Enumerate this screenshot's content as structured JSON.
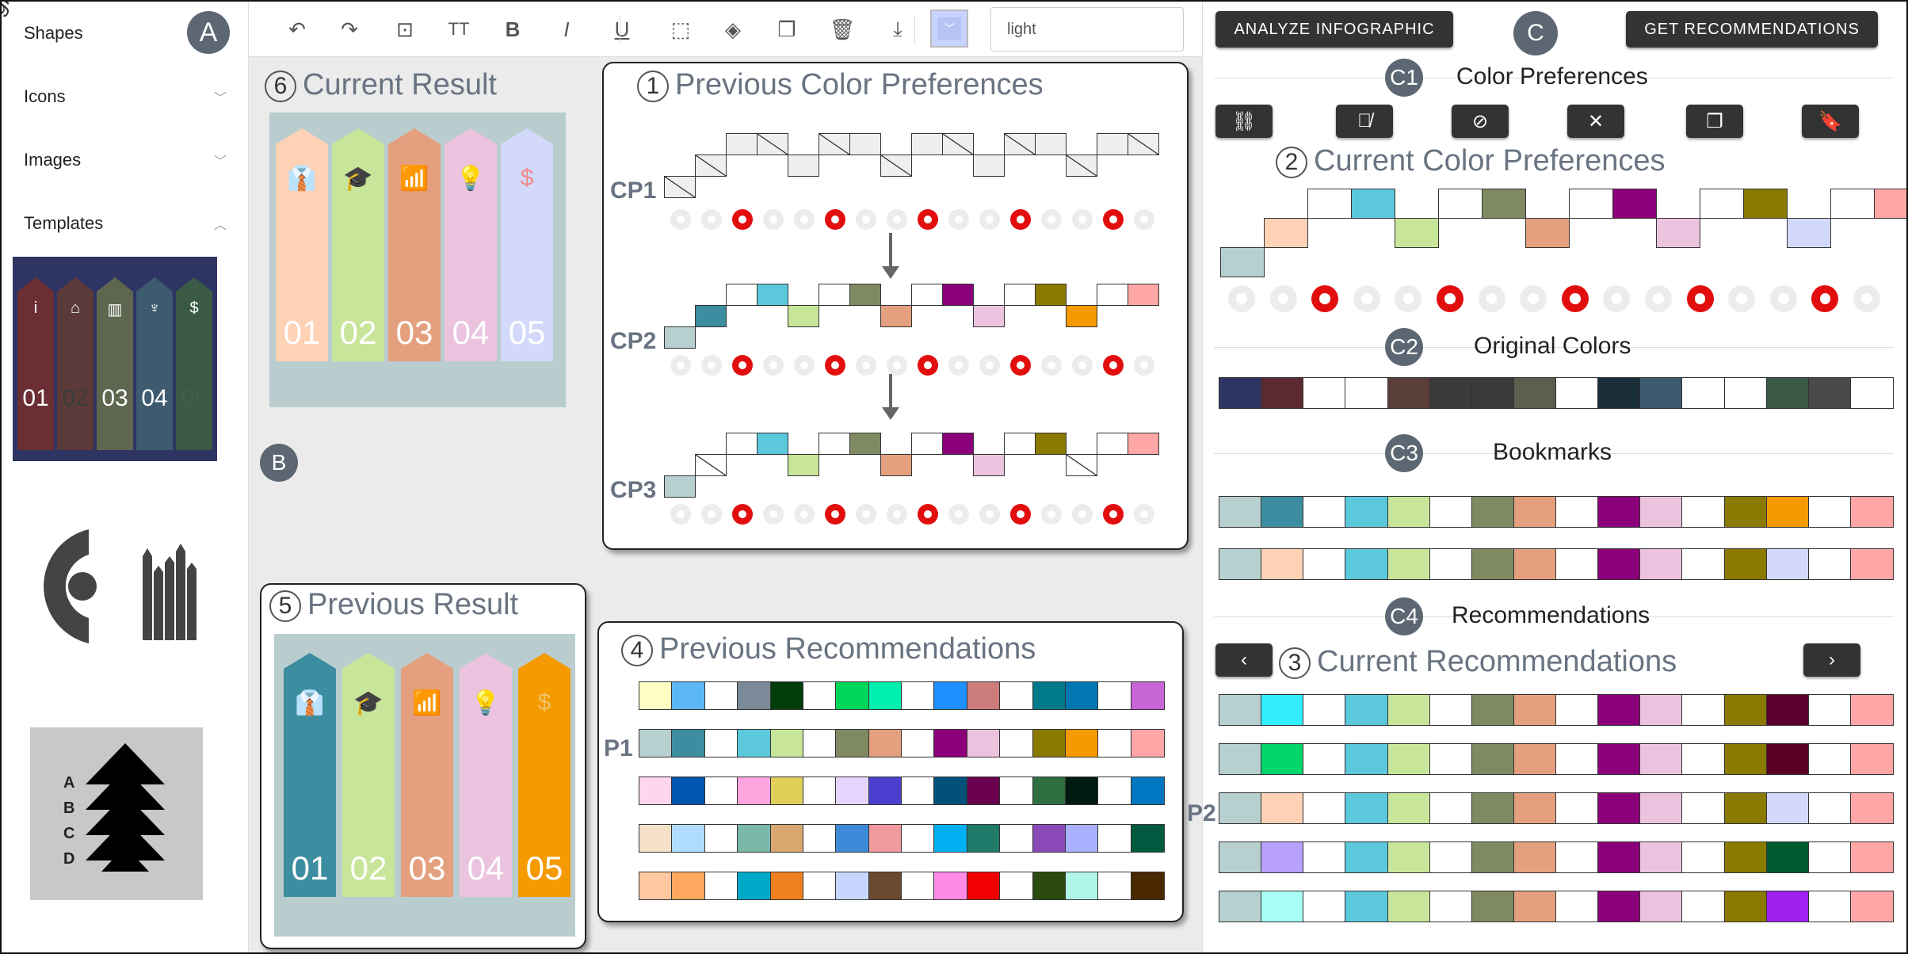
{
  "sidebar": {
    "items": [
      {
        "label": "Shapes",
        "chevron": ""
      },
      {
        "label": "Icons",
        "chevron": "﹀"
      },
      {
        "label": "Images",
        "chevron": "﹀"
      },
      {
        "label": "Templates",
        "chevron": "︿"
      }
    ],
    "badge_a": "A",
    "template": {
      "numbers": [
        "01",
        "02",
        "03",
        "04",
        "05"
      ],
      "colors": [
        "#6b2e34",
        "#5c3a3a",
        "#5f6650",
        "#3d5a6e",
        "#3a5a45"
      ],
      "num_colors": [
        "#ffffff",
        "#3b3b3b",
        "#ffffff",
        "#ffffff",
        "#3f5f46"
      ]
    },
    "letters": [
      "A",
      "B",
      "C",
      "D"
    ]
  },
  "toolbar": {
    "icons": [
      "undo-icon",
      "redo-icon",
      "text-box-icon",
      "font-size-icon",
      "bold-icon",
      "italic-icon",
      "underline-icon",
      "select-icon",
      "layers-icon",
      "copy-icon",
      "delete-icon",
      "download-icon"
    ],
    "glyphs": [
      "↶",
      "↷",
      "⊡",
      "TT",
      "B",
      "I",
      "U",
      "⬚",
      "◈",
      "❐",
      "🗑",
      "⤓"
    ],
    "text_value": "light",
    "picker_color": "#c7d4ff"
  },
  "canvas": {
    "badge_b": "B",
    "current_result": {
      "num": "6",
      "title": "Current Result"
    },
    "previous_result": {
      "num": "5",
      "title": "Previous Result"
    },
    "previous_prefs": {
      "num": "1",
      "title": "Previous Color Preferences"
    },
    "previous_recs": {
      "num": "4",
      "title": "Previous Recommendations"
    },
    "infographic_numbers": [
      "01",
      "02",
      "03",
      "04",
      "05"
    ],
    "current_colors": [
      "#ffd1b5",
      "#c8e69a",
      "#e4a07e",
      "#ebc3df",
      "#d2d9fb"
    ],
    "current_icon_colors": [
      "#3aa6d3",
      "#555555",
      "#8b1a5c",
      "#8b6a00",
      "#f28c8c"
    ],
    "previous_colors": [
      "#3d8da0",
      "#c8e69a",
      "#e4a07e",
      "#ebc3df",
      "#f59a00"
    ],
    "previous_icon_colors": [
      "#7fd4e8",
      "#8b8b40",
      "#8b1a5c",
      "#8b6a00",
      "#f2c46a"
    ],
    "cp_labels": [
      "CP1",
      "CP2",
      "CP3"
    ],
    "stair_word": "light",
    "p1_label": "P1",
    "rec_rows": [
      [
        "#ffffc4",
        "#5bb8f5",
        "#ffffff",
        "#7a8a99",
        "#003d0a",
        "#ffffff",
        "#00d65a",
        "#00f0b0",
        "#ffffff",
        "#1e90ff",
        "#cd7c7c",
        "#ffffff",
        "#007a8a",
        "#0077b3",
        "#ffffff",
        "#c866d8"
      ],
      [
        "#b7cfcf",
        "#3d8da0",
        "#ffffff",
        "#5bc8dc",
        "#c8e69a",
        "#ffffff",
        "#7f8a62",
        "#e4a07e",
        "#ffffff",
        "#8b007a",
        "#ebc3df",
        "#ffffff",
        "#8b7a00",
        "#f59a00",
        "#ffffff",
        "#ffa6a6"
      ],
      [
        "#ffd6f0",
        "#0055b0",
        "#ffffff",
        "#ffa6e0",
        "#e0d05a",
        "#ffffff",
        "#e6d6ff",
        "#4a3fcf",
        "#ffffff",
        "#00507a",
        "#6a0050",
        "#ffffff",
        "#2e6e40",
        "#001a10",
        "#ffffff",
        "#0077c0"
      ],
      [
        "#f5e0c8",
        "#b0dcff",
        "#ffffff",
        "#7ab8a8",
        "#d8a870",
        "#ffffff",
        "#3d8ad8",
        "#f09aa0",
        "#ffffff",
        "#00b0f0",
        "#1f7a6a",
        "#ffffff",
        "#8a4ab8",
        "#a8b0ff",
        "#ffffff",
        "#005a40"
      ],
      [
        "#ffc8a0",
        "#ffa860",
        "#ffffff",
        "#00a8c8",
        "#f08020",
        "#ffffff",
        "#c8d6ff",
        "#6b4a30",
        "#ffffff",
        "#ff8ae8",
        "#f00000",
        "#ffffff",
        "#2a4a10",
        "#b0f5e8",
        "#ffffff",
        "#4a2800"
      ]
    ]
  },
  "right": {
    "analyze_label": "ANALYZE INFOGRAPHIC",
    "recommend_label": "GET RECOMMENDATIONS",
    "badge_c": "C",
    "c1": {
      "badge": "C1",
      "title": "Color Preferences"
    },
    "c2": {
      "badge": "C2",
      "title": "Original Colors"
    },
    "c3": {
      "badge": "C3",
      "title": "Bookmarks"
    },
    "c4": {
      "badge": "C4",
      "title": "Recommendations"
    },
    "current_prefs": {
      "num": "2",
      "title": "Current Color Preferences"
    },
    "current_recs": {
      "num": "3",
      "title": "Current Recommendations"
    },
    "p2_label": "P2",
    "pref_icons": [
      "link-icon",
      "unlink-icon",
      "clear-format-icon",
      "close-icon",
      "copy-icon",
      "bookmark-icon"
    ],
    "pref_glyphs": [
      "⛓",
      "⛓̸",
      "⊘",
      "✕",
      "❐",
      "🔖"
    ],
    "nav_prev": "‹",
    "nav_next": "›",
    "current_pref_colors": [
      "#b7cfcf",
      "#ffd1b5",
      "#ffffff",
      "#5bc8dc",
      "#c8e69a",
      "#ffffff",
      "#7f8a62",
      "#e4a07e",
      "#ffffff",
      "#8b007a",
      "#ebc3df",
      "#ffffff",
      "#8b7a00",
      "#d2d9fb",
      "#ffffff",
      "#ffa6a6"
    ],
    "original_colors": [
      "#2f3563",
      "#5a2a30",
      "#ffffff",
      "#ffffff",
      "#5a3e3a",
      "#3a3a3a",
      "#3a3a3a",
      "#5a5f4e",
      "#ffffff",
      "#1a2e3a",
      "#3d5a6e",
      "#ffffff",
      "#ffffff",
      "#3a5a45",
      "#4a4a4a",
      "#ffffff"
    ],
    "bookmarks": [
      [
        "#b7cfcf",
        "#3d8da0",
        "#ffffff",
        "#5bc8dc",
        "#c8e69a",
        "#ffffff",
        "#7f8a62",
        "#e4a07e",
        "#ffffff",
        "#8b007a",
        "#ebc3df",
        "#ffffff",
        "#8b7a00",
        "#f59a00",
        "#ffffff",
        "#ffa6a6"
      ],
      [
        "#b7cfcf",
        "#ffd1b5",
        "#ffffff",
        "#5bc8dc",
        "#c8e69a",
        "#ffffff",
        "#7f8a62",
        "#e4a07e",
        "#ffffff",
        "#8b007a",
        "#ebc3df",
        "#ffffff",
        "#8b7a00",
        "#d2d9fb",
        "#ffffff",
        "#ffa6a6"
      ]
    ],
    "recommendations": [
      [
        "#b7cfcf",
        "#33eeff",
        "#ffffff",
        "#5bc8dc",
        "#c8e69a",
        "#ffffff",
        "#7f8a62",
        "#e4a07e",
        "#ffffff",
        "#8b007a",
        "#ebc3df",
        "#ffffff",
        "#8b7a00",
        "#5a0030",
        "#ffffff",
        "#ffa6a6"
      ],
      [
        "#b7cfcf",
        "#00d66a",
        "#ffffff",
        "#5bc8dc",
        "#c8e69a",
        "#ffffff",
        "#7f8a62",
        "#e4a07e",
        "#ffffff",
        "#8b007a",
        "#ebc3df",
        "#ffffff",
        "#8b7a00",
        "#5a0025",
        "#ffffff",
        "#ffa6a6"
      ],
      [
        "#b7cfcf",
        "#ffd1b5",
        "#ffffff",
        "#5bc8dc",
        "#c8e69a",
        "#ffffff",
        "#7f8a62",
        "#e4a07e",
        "#ffffff",
        "#8b007a",
        "#ebc3df",
        "#ffffff",
        "#8b7a00",
        "#d2d9fb",
        "#ffffff",
        "#ffa6a6"
      ],
      [
        "#b7cfcf",
        "#b8a0ff",
        "#ffffff",
        "#5bc8dc",
        "#c8e69a",
        "#ffffff",
        "#7f8a62",
        "#e4a07e",
        "#ffffff",
        "#8b007a",
        "#ebc3df",
        "#ffffff",
        "#8b7a00",
        "#005a30",
        "#ffffff",
        "#ffa6a6"
      ],
      [
        "#b7cfcf",
        "#a8fff5",
        "#ffffff",
        "#5bc8dc",
        "#c8e69a",
        "#ffffff",
        "#7f8a62",
        "#e4a07e",
        "#ffffff",
        "#8b007a",
        "#ebc3df",
        "#ffffff",
        "#8b7a00",
        "#a020f0",
        "#ffffff",
        "#ffa6a6"
      ]
    ]
  }
}
